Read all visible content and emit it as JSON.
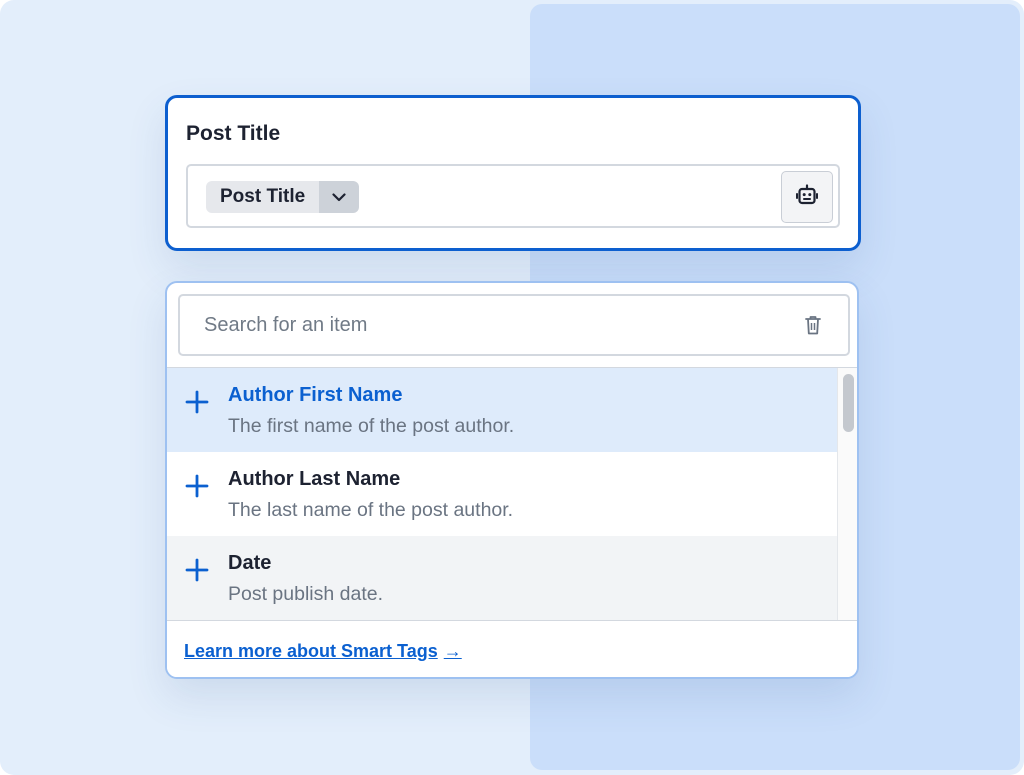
{
  "colors": {
    "accent": "#0b60d0",
    "highlight_bg": "#deebfb",
    "text": "#1d2231",
    "muted": "#6a7482"
  },
  "title_card": {
    "label": "Post Title",
    "tag_chip": {
      "label": "Post Title",
      "caret_icon": "chevron-down-icon"
    },
    "smart_tag_button_icon": "robot-icon"
  },
  "dropdown": {
    "search": {
      "placeholder": "Search for an item",
      "value": "",
      "clear_icon": "trash-icon"
    },
    "items": [
      {
        "name": "Author First Name",
        "description": "The first name of the post author.",
        "icon": "plus-icon",
        "state": "highlighted"
      },
      {
        "name": "Author Last Name",
        "description": "The last name of the post author.",
        "icon": "plus-icon",
        "state": "normal"
      },
      {
        "name": "Date",
        "description": "Post publish date.",
        "icon": "plus-icon",
        "state": "alternate"
      }
    ],
    "footer": {
      "link_text": "Learn more about Smart Tags",
      "arrow": "→"
    }
  }
}
